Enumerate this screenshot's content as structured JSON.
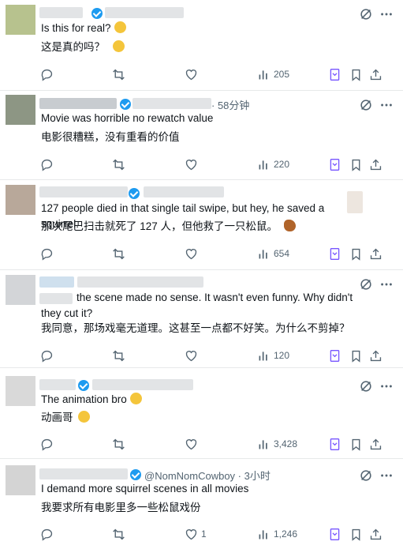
{
  "posts": [
    {
      "text_en": "Is this for real?",
      "text_zh": "这是真的吗？",
      "emoji_en": "grinning-sweat-emoji",
      "emoji_zh": "grinning-sweat-emoji",
      "time": "",
      "views": "205",
      "replies": "",
      "reposts": "",
      "likes": ""
    },
    {
      "text_en": "Movie was horrible no rewatch value",
      "text_zh": "电影很糟糕，没有重看的价值",
      "time": "· 58分钟",
      "views": "220",
      "replies": "",
      "reposts": "",
      "likes": ""
    },
    {
      "text_en": "127 people died in that single tail swipe, but hey, he saved a squirrel.",
      "text_zh": "那次尾巴扫击就死了 127 人，但他救了一只松鼠。",
      "time": "",
      "views": "654",
      "replies": "",
      "reposts": "",
      "likes": ""
    },
    {
      "text_en": "the scene made no sense. It wasn't even funny. Why didn't they cut it?",
      "text_zh": "我同意，那场戏毫无道理。这甚至一点都不好笑。为什么不剪掉？",
      "time": "",
      "views": "120",
      "replies": "",
      "reposts": "",
      "likes": ""
    },
    {
      "text_en": "The animation bro",
      "text_zh": "动画哥",
      "time": "",
      "views": "3,428",
      "replies": "",
      "reposts": "",
      "likes": ""
    },
    {
      "text_en": "I demand more squirrel scenes in all movies",
      "text_zh": "我要求所有电影里多一些松鼠戏份",
      "handle": "@NomNomCowboy · 3小时",
      "views": "1,246",
      "replies": "",
      "reposts": "",
      "likes": "1"
    }
  ],
  "colors": {
    "accent": "#1d9bf0",
    "muted": "#536471",
    "grok": "#7856ff",
    "divider": "#e7e9ea"
  }
}
